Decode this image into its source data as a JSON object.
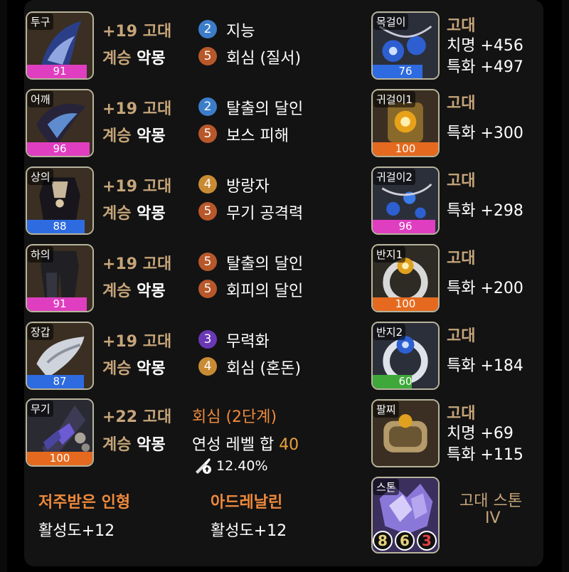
{
  "left_items": [
    {
      "slot": "투구",
      "quality": 91,
      "quality_color": "#e03ec0",
      "upgrade": "+19",
      "grade": "고대",
      "succession_label": "계승",
      "succession_value": "악몽",
      "effects": [
        {
          "level": "2",
          "color": "blue",
          "name": "지능"
        },
        {
          "level": "5",
          "color": "orange",
          "name": "회심 (질서)"
        }
      ]
    },
    {
      "slot": "어깨",
      "quality": 96,
      "quality_color": "#e03ec0",
      "upgrade": "+19",
      "grade": "고대",
      "succession_label": "계승",
      "succession_value": "악몽",
      "effects": [
        {
          "level": "2",
          "color": "blue",
          "name": "탈출의 달인"
        },
        {
          "level": "5",
          "color": "orange",
          "name": "보스 피해"
        }
      ]
    },
    {
      "slot": "상의",
      "quality": 88,
      "quality_color": "#2e6be0",
      "upgrade": "+19",
      "grade": "고대",
      "succession_label": "계승",
      "succession_value": "악몽",
      "effects": [
        {
          "level": "4",
          "color": "gold",
          "name": "방랑자"
        },
        {
          "level": "5",
          "color": "orange",
          "name": "무기 공격력"
        }
      ]
    },
    {
      "slot": "하의",
      "quality": 91,
      "quality_color": "#e03ec0",
      "upgrade": "+19",
      "grade": "고대",
      "succession_label": "계승",
      "succession_value": "악몽",
      "effects": [
        {
          "level": "5",
          "color": "orange",
          "name": "탈출의 달인"
        },
        {
          "level": "5",
          "color": "orange",
          "name": "회피의 달인"
        }
      ]
    },
    {
      "slot": "장갑",
      "quality": 87,
      "quality_color": "#2e6be0",
      "upgrade": "+19",
      "grade": "고대",
      "succession_label": "계승",
      "succession_value": "악몽",
      "effects": [
        {
          "level": "3",
          "color": "purple",
          "name": "무력화"
        },
        {
          "level": "4",
          "color": "gold",
          "name": "회심 (혼돈)"
        }
      ]
    }
  ],
  "weapon": {
    "slot": "무기",
    "quality": 100,
    "quality_color": "#e56a1f",
    "upgrade": "+22",
    "grade": "고대",
    "succession_label": "계승",
    "succession_value": "악몽",
    "effect": "회심 (2단계)",
    "refine_label": "연성 레벨 합",
    "refine_value": "40",
    "percent": "12.40%"
  },
  "bracelets": [
    {
      "name": "저주받은 인형",
      "stat": "활성도+12"
    },
    {
      "name": "아드레날린",
      "stat": "활성도+12"
    }
  ],
  "right_items": [
    {
      "slot": "목걸이",
      "quality": 76,
      "quality_color": "#2e6be0",
      "grade": "고대",
      "stats": [
        "치명 +456",
        "특화 +497"
      ]
    },
    {
      "slot": "귀걸이1",
      "quality": 100,
      "quality_color": "#e56a1f",
      "grade": "고대",
      "stats": [
        "특화 +300"
      ]
    },
    {
      "slot": "귀걸이2",
      "quality": 96,
      "quality_color": "#e03ec0",
      "grade": "고대",
      "stats": [
        "특화 +298"
      ]
    },
    {
      "slot": "반지1",
      "quality": 100,
      "quality_color": "#e56a1f",
      "grade": "고대",
      "stats": [
        "특화 +200"
      ]
    },
    {
      "slot": "반지2",
      "quality": 60,
      "quality_color": "#3ea83a",
      "grade": "고대",
      "stats": [
        "특화 +184"
      ]
    },
    {
      "slot": "팔찌",
      "quality": null,
      "quality_color": null,
      "grade": "고대",
      "stats": [
        "치명 +69",
        "특화 +115"
      ]
    }
  ],
  "stone": {
    "slot": "스톤",
    "title": "고대 스톤",
    "tier": "IV",
    "values": [
      {
        "value": "8",
        "color": "#e8d27a"
      },
      {
        "value": "6",
        "color": "#e8d27a"
      },
      {
        "value": "3",
        "color": "#e54040"
      }
    ]
  }
}
